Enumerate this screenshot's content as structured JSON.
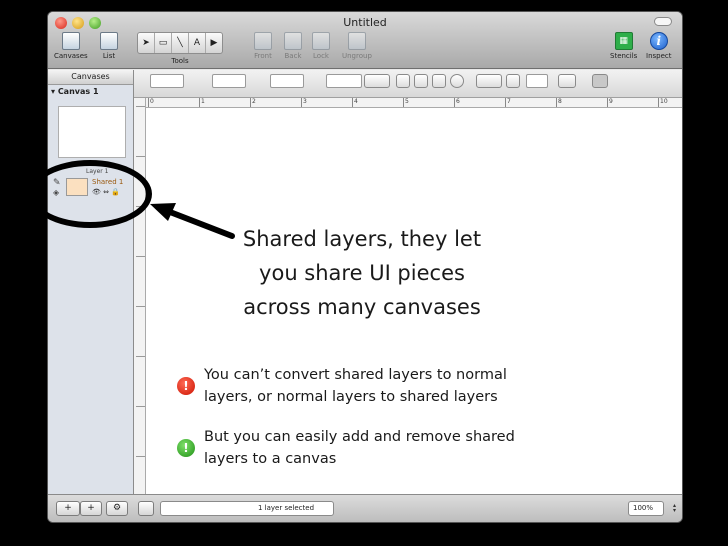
{
  "window": {
    "title": "Untitled"
  },
  "toolbar": {
    "canvases_label": "Canvases",
    "list_label": "List",
    "tools_label": "Tools",
    "tool_text": "A",
    "front_label": "Front",
    "back_label": "Back",
    "lock_label": "Lock",
    "ungroup_label": "Ungroup",
    "stencils_label": "Stencils",
    "inspect_label": "Inspect",
    "inspect_glyph": "i"
  },
  "sidebar": {
    "header": "Canvases",
    "canvas_name": "Canvas 1",
    "layer_name": "Layer 1",
    "shared_layer_name": "Shared 1"
  },
  "ruler": {
    "ticks": [
      "0",
      "1",
      "2",
      "3",
      "4",
      "5",
      "6",
      "7",
      "8",
      "9",
      "10"
    ]
  },
  "bottom": {
    "status": "1 layer selected",
    "zoom": "100%"
  },
  "callout": {
    "line1": "Shared layers, they let",
    "line2": "you share UI pieces",
    "line3": "across many canvases"
  },
  "notes": {
    "warning_glyph": "!",
    "warning_line1": "You can’t convert shared layers to normal",
    "warning_line2": "layers, or normal layers to shared layers",
    "tip_glyph": "!",
    "tip_line1": "But you can easily add and remove shared",
    "tip_line2": "layers to a canvas"
  },
  "colors": {
    "warning": "#cc1200",
    "tip": "#1f8f14",
    "shared_layer": "#9a5a10"
  }
}
